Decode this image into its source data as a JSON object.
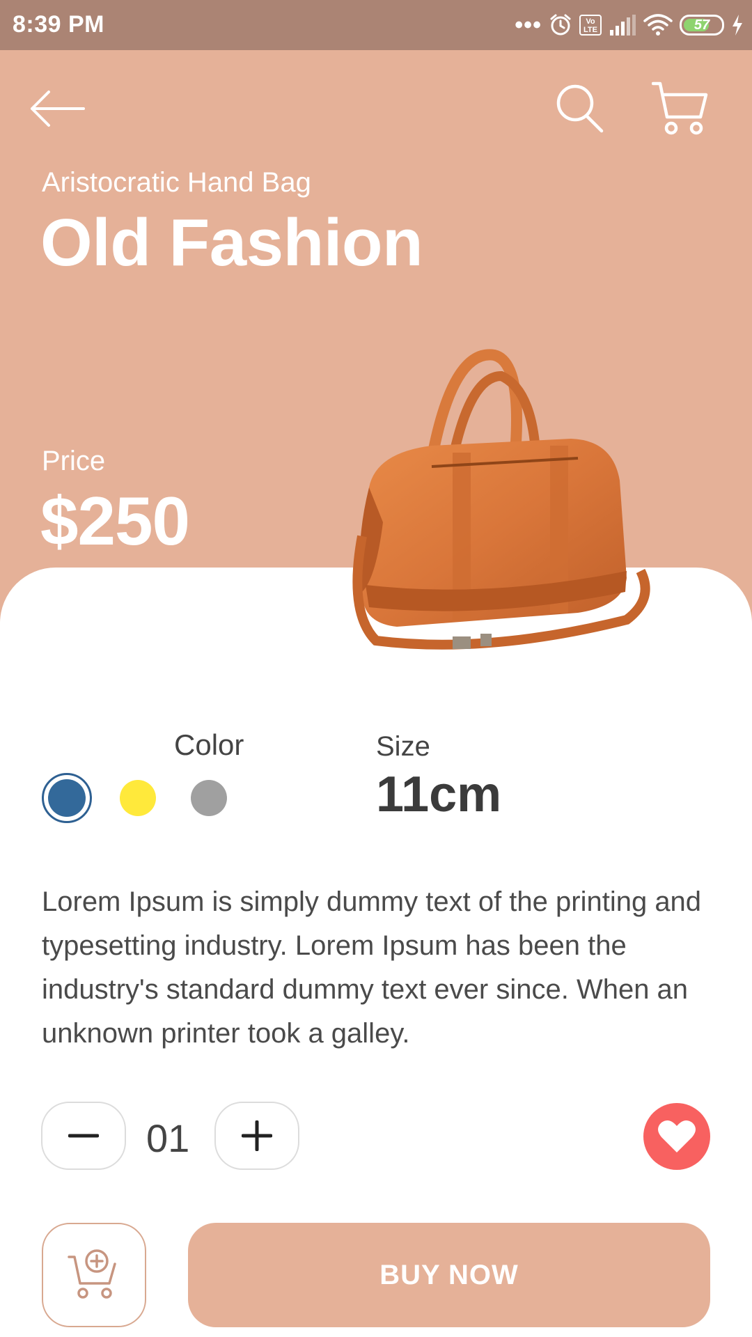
{
  "status_bar": {
    "time": "8:39 PM",
    "dots": "•••",
    "volte": "Vo LTE",
    "battery": "57"
  },
  "product": {
    "subtitle": "Aristocratic Hand Bag",
    "title": "Old Fashion",
    "price_label": "Price",
    "price": "$250",
    "color_label": "Color",
    "colors": [
      "#33699a",
      "#ffe93b",
      "#a0a0a0"
    ],
    "selected_color": "#33699a",
    "size_label": "Size",
    "size": "11cm",
    "description": "Lorem Ipsum is simply dummy text of the printing and typesetting industry. Lorem Ipsum has been the industry's standard dummy text ever since. When an unknown printer took a galley."
  },
  "quantity": {
    "value": "01"
  },
  "actions": {
    "buy_label": "BUY NOW"
  },
  "icons": {
    "back": "back-arrow-icon",
    "search": "search-icon",
    "cart": "cart-icon",
    "minus": "minus-icon",
    "plus": "plus-icon",
    "favorite": "heart-icon",
    "add_to_cart": "add-to-cart-icon"
  },
  "theme": {
    "accent": "#e5b198",
    "status_bar": "#ab8474",
    "favorite": "#f86160"
  }
}
